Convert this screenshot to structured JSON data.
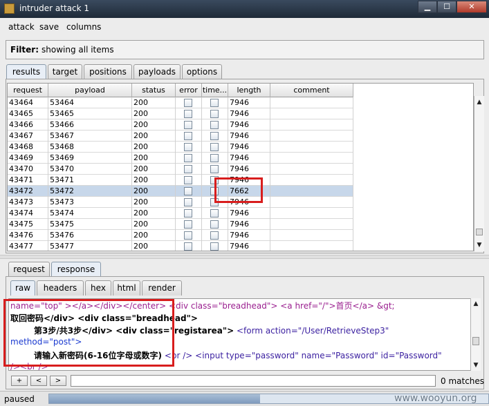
{
  "window": {
    "title": "intruder attack 1",
    "min": "▁",
    "max": "☐",
    "close": "✕"
  },
  "menu": [
    "attack",
    "save",
    "columns"
  ],
  "filter": {
    "label": "Filter:",
    "value": "showing all items"
  },
  "main_tabs": [
    "results",
    "target",
    "positions",
    "payloads",
    "options"
  ],
  "table": {
    "headers": [
      "request",
      "payload",
      "status",
      "error",
      "time...",
      "length",
      "comment"
    ],
    "rows": [
      {
        "request": "43464",
        "payload": "53464",
        "status": "200",
        "length": "7946"
      },
      {
        "request": "43465",
        "payload": "53465",
        "status": "200",
        "length": "7946"
      },
      {
        "request": "43466",
        "payload": "53466",
        "status": "200",
        "length": "7946"
      },
      {
        "request": "43467",
        "payload": "53467",
        "status": "200",
        "length": "7946"
      },
      {
        "request": "43468",
        "payload": "53468",
        "status": "200",
        "length": "7946"
      },
      {
        "request": "43469",
        "payload": "53469",
        "status": "200",
        "length": "7946"
      },
      {
        "request": "43470",
        "payload": "53470",
        "status": "200",
        "length": "7946"
      },
      {
        "request": "43471",
        "payload": "53471",
        "status": "200",
        "length": "7946"
      },
      {
        "request": "43472",
        "payload": "53472",
        "status": "200",
        "length": "7662"
      },
      {
        "request": "43473",
        "payload": "53473",
        "status": "200",
        "length": "7946"
      },
      {
        "request": "43474",
        "payload": "53474",
        "status": "200",
        "length": "7946"
      },
      {
        "request": "43475",
        "payload": "53475",
        "status": "200",
        "length": "7946"
      },
      {
        "request": "43476",
        "payload": "53476",
        "status": "200",
        "length": "7946"
      },
      {
        "request": "43477",
        "payload": "53477",
        "status": "200",
        "length": "7946"
      }
    ],
    "selected_index": 8
  },
  "detail_tabs": [
    "request",
    "response"
  ],
  "view_tabs": [
    "raw",
    "headers",
    "hex",
    "html",
    "render"
  ],
  "code": {
    "l1a": "name=\"top\" ></a></div></center>",
    "l1b": " <div class=\"breadhead\"> <a href=\"/\">首页</a> &gt;",
    "l2": "取回密码</div> <div class=\"breadhead\">",
    "l3a": "第3步/共3步</div> <div class=\"registarea\">",
    "l3b": " <form action=\"/User/RetrieveStep3\"",
    "l4": "method=\"post\">",
    "l5a": "请输入新密码(6-16位字母或数字)",
    "l5b": " <br /> <input type=\"password\" name=\"Password\" id=\"Password\"",
    "l6": "/><br />"
  },
  "search": {
    "plus": "+",
    "prev": "<",
    "next": ">",
    "value": "",
    "matches": "0 matches"
  },
  "status": {
    "text": "paused",
    "progress": 0.48
  },
  "watermark": "www.wooyun.org"
}
